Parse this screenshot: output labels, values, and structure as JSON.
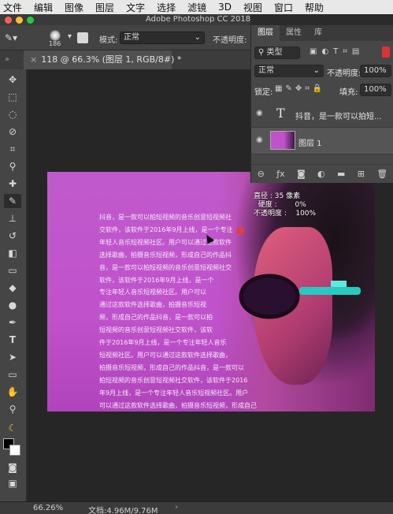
{
  "menubar": {
    "items": [
      "文件",
      "编辑",
      "图像",
      "图层",
      "文字",
      "选择",
      "滤镜",
      "3D",
      "视图",
      "窗口",
      "帮助"
    ]
  },
  "window": {
    "title": "Adobe Photoshop CC 2018"
  },
  "options_bar": {
    "brush_size": "186",
    "mode_label": "模式:",
    "mode_value": "正常",
    "opacity_label": "不透明度:"
  },
  "document_tab": {
    "label": "118 @ 66.3% (图层 1, RGB/8#) *"
  },
  "canvas": {
    "body_text": "抖音，是一款可以拍短视频的音乐创意短视频社\n交软件，该软件于2016年9月上线，是一个专注\n年轻人音乐短视频社区。用户可以通过这款软件\n选择歌曲，拍摄音乐短视频，形成自己的作品抖\n音，是一款可以拍短视频的音乐创意短视频社交\n软件，该软件于2016年9月上线，是一个\n专注年轻人音乐短视频社区。用户可以\n通过这款软件选择歌曲，拍摄音乐短视\n频，形成自己的作品抖音，是一款可以拍\n短视频的音乐创意短视频社交软件，该软\n件于2016年9月上线，是一个专注年轻人音乐\n短视频社区。用户可以通过这款软件选择歌曲，\n拍摄音乐短视频，形成自己的作品抖音，是一款可以\n拍短视频的音乐创意短视频社交软件，该软件于2016\n年9月上线，是一个专注年轻人音乐短视频社区。用户\n可以通过这款软件选择歌曲，拍摄音乐短视频，形成自己",
    "brush_info": "直径 : 35 像素\n  硬度 :        0%\n不透明度 :    100%"
  },
  "layers_panel": {
    "tabs": [
      "图层",
      "属性",
      "库"
    ],
    "filter_label": "类型",
    "blend_mode": "正常",
    "opacity_label": "不透明度:",
    "opacity_value": "100%",
    "lock_label": "锁定:",
    "fill_label": "填充:",
    "fill_value": "100%",
    "layers": [
      {
        "name": "抖音，是一款可以拍短...",
        "kind": "text",
        "visible": true
      },
      {
        "name": "图层 1",
        "kind": "pixel",
        "visible": true
      }
    ]
  },
  "status": {
    "zoom": "66.26%",
    "doc_size": "文档:4.96M/9.76M"
  },
  "colors": {
    "accent_magenta": "#c052cc",
    "close": "#ff5f57",
    "minimize": "#febc2e",
    "maximize": "#28c840"
  }
}
